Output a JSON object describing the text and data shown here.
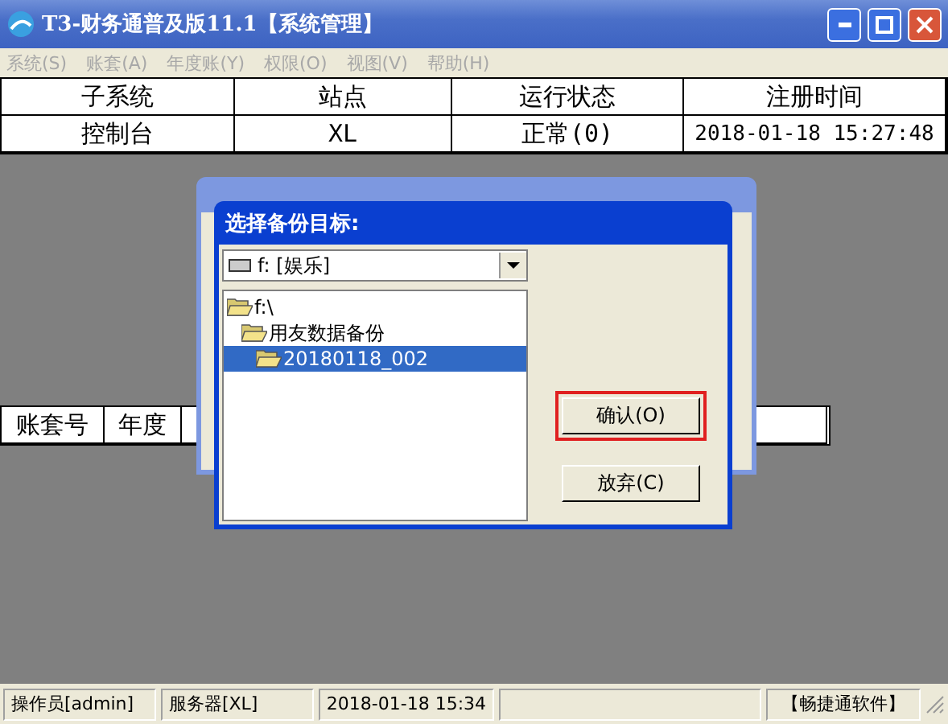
{
  "window": {
    "title": "T3-财务通普及版11.1【系统管理】"
  },
  "menu": [
    {
      "label": "系统(S)",
      "disabled": true
    },
    {
      "label": "账套(A)",
      "disabled": true
    },
    {
      "label": "年度账(Y)",
      "disabled": true
    },
    {
      "label": "权限(O)",
      "disabled": true
    },
    {
      "label": "视图(V)",
      "disabled": true
    },
    {
      "label": "帮助(H)",
      "disabled": true
    }
  ],
  "subsystem_table": {
    "columns": [
      "子系统",
      "站点",
      "运行状态",
      "注册时间"
    ],
    "rows": [
      [
        "控制台",
        "XL",
        "正常(0)",
        "2018-01-18 15:27:48"
      ]
    ]
  },
  "account_table": {
    "columns": [
      "账套号",
      "年度"
    ]
  },
  "dialog": {
    "title": "选择备份目标:",
    "drive": "f: [娱乐]",
    "tree": [
      {
        "label": "f:\\",
        "selected": false,
        "children": [
          {
            "label": "用友数据备份",
            "selected": false,
            "children": [
              {
                "label": "20180118_002",
                "selected": true
              }
            ]
          }
        ]
      }
    ],
    "buttons": [
      {
        "label": "确认(O)",
        "highlighted": true
      },
      {
        "label": "放弃(C)",
        "highlighted": false
      }
    ]
  },
  "status_bar": [
    "操作员[admin]",
    "服务器[XL]",
    "2018-01-18 15:34",
    "【畅捷通软件】"
  ]
}
